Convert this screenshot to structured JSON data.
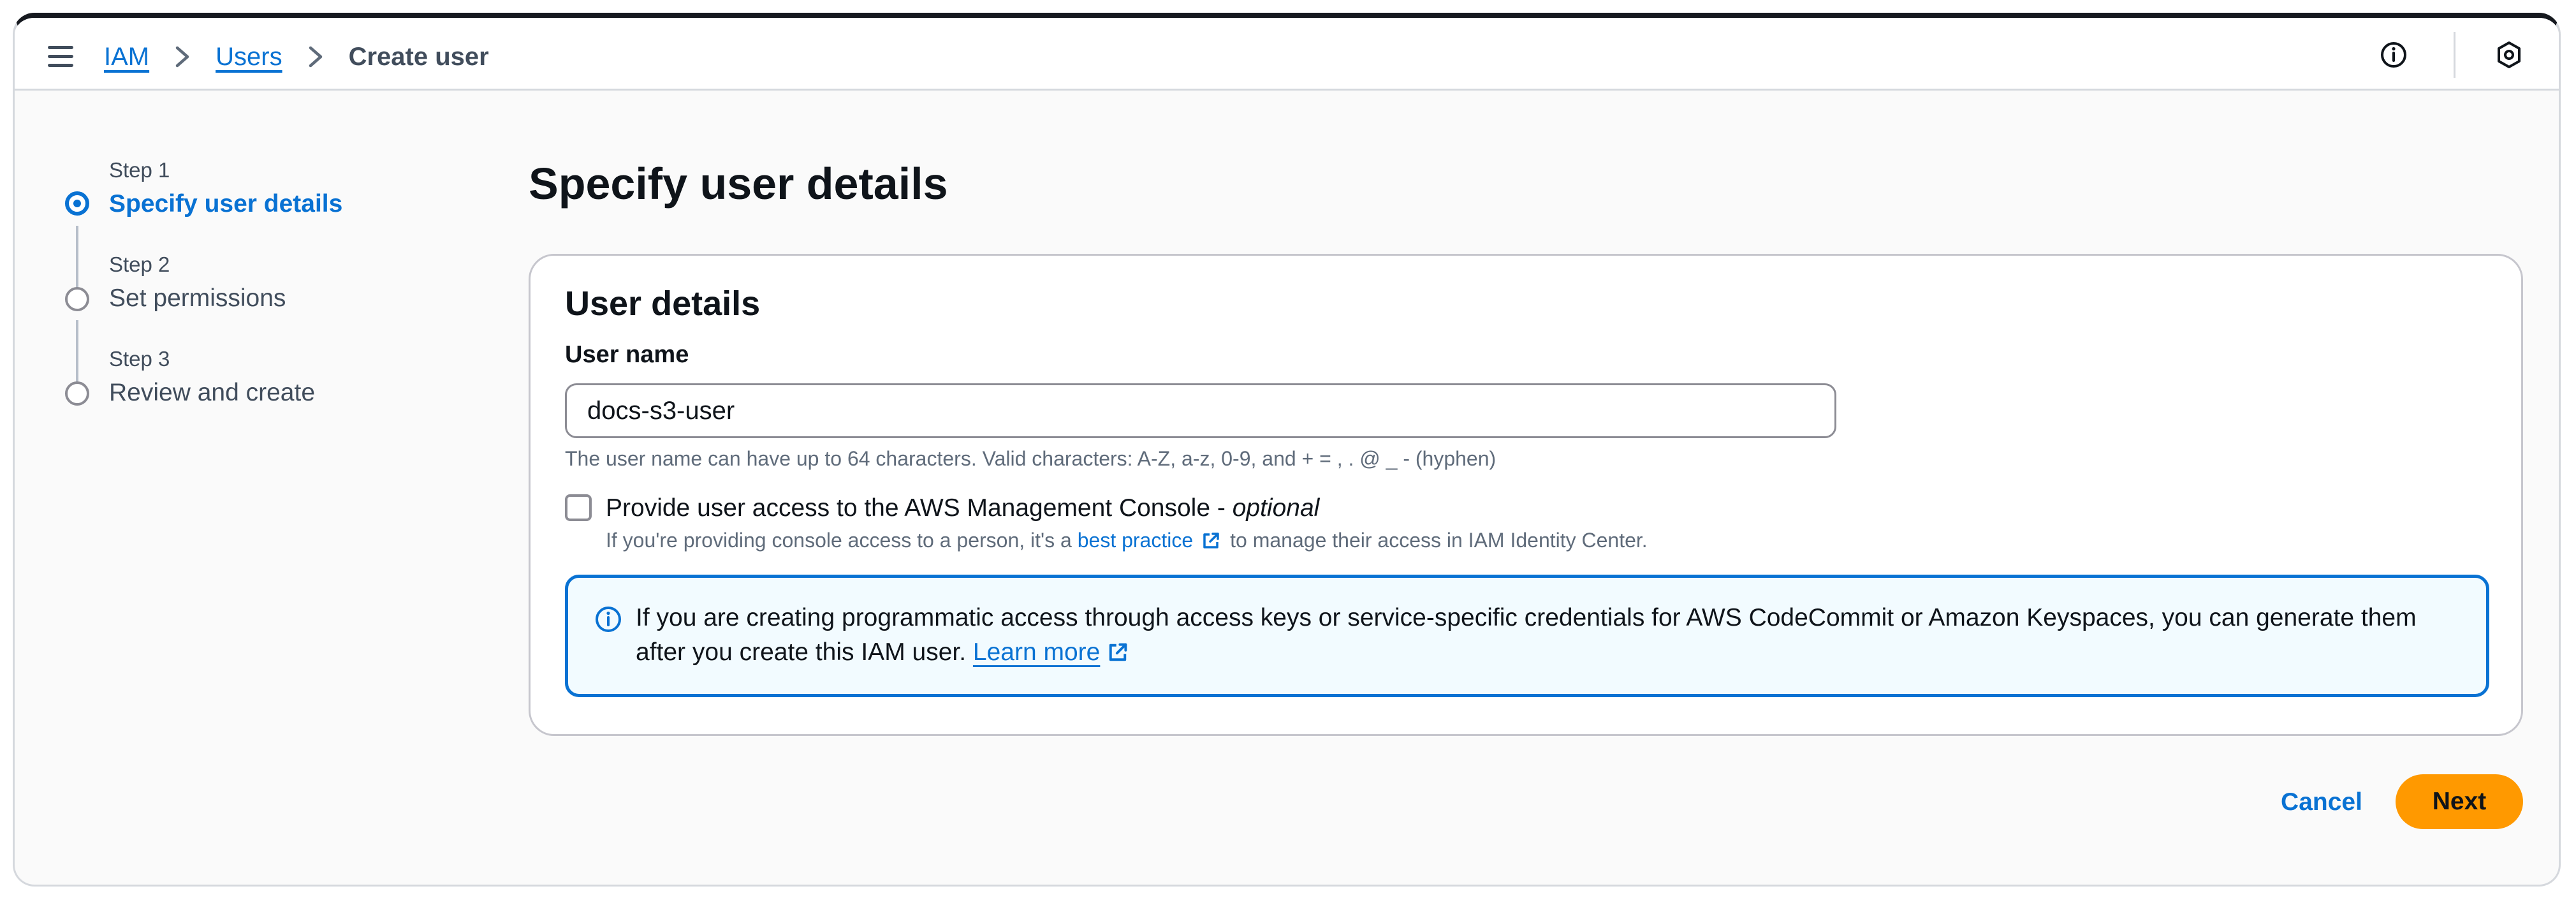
{
  "breadcrumb": {
    "items": [
      "IAM",
      "Users"
    ],
    "current": "Create user"
  },
  "stepper": {
    "steps": [
      {
        "number": "Step 1",
        "title": "Specify user details",
        "state": "active"
      },
      {
        "number": "Step 2",
        "title": "Set permissions",
        "state": "inactive"
      },
      {
        "number": "Step 3",
        "title": "Review and create",
        "state": "inactive"
      }
    ]
  },
  "main": {
    "page_title": "Specify user details",
    "section_title": "User details",
    "user_name_label": "User name",
    "user_name_value": "docs-s3-user",
    "user_name_constraint": "The user name can have up to 64 characters. Valid characters: A-Z, a-z, 0-9, and + = , . @ _ - (hyphen)",
    "console_access_label": "Provide user access to the AWS Management Console - ",
    "console_access_optional": "optional",
    "console_access_checked": false,
    "console_desc_before": "If you're providing console access to a person, it's a ",
    "console_desc_link": "best practice",
    "console_desc_after": "to manage their access in IAM Identity Center.",
    "alert_text": "If you are creating programmatic access through access keys or service-specific credentials for AWS CodeCommit or Amazon Keyspaces, you can generate them after you create this IAM user. ",
    "alert_link": "Learn more"
  },
  "actions": {
    "cancel_label": "Cancel",
    "next_label": "Next"
  },
  "colors": {
    "accent": "#0972d3",
    "primary_button": "#ff9900",
    "alert_background": "#f2fbff"
  },
  "icons": [
    "menu-icon",
    "chevron-right-icon",
    "info-icon",
    "settings-hexagon-icon",
    "external-link-icon"
  ]
}
